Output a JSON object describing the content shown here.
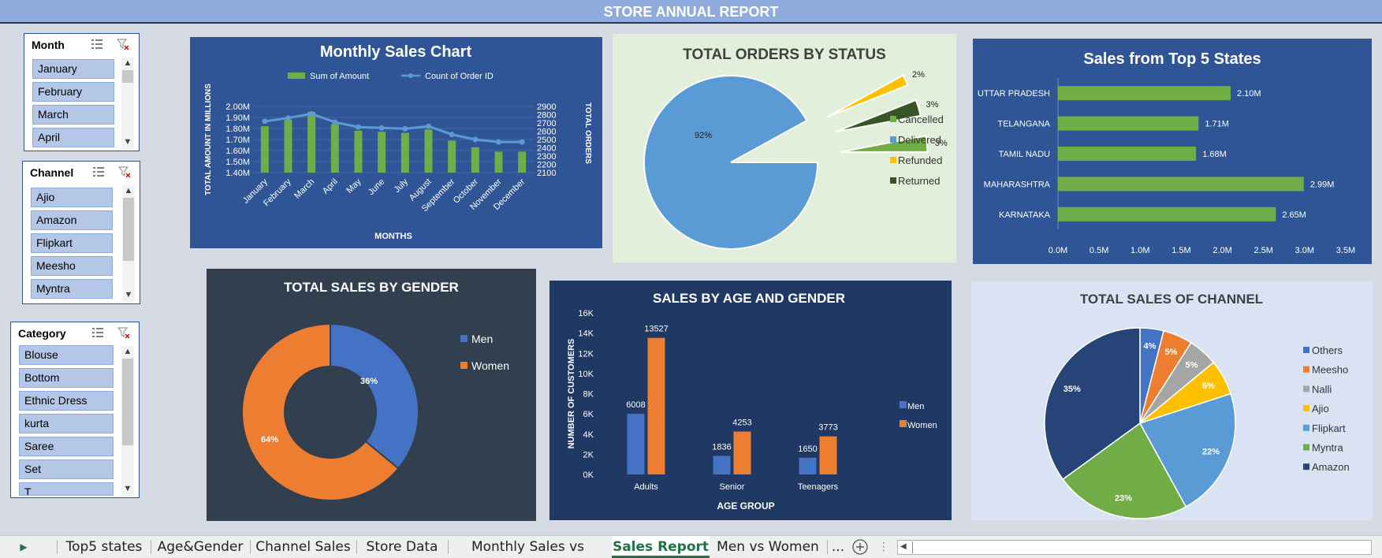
{
  "report_title": "STORE ANNUAL REPORT",
  "slicers": {
    "month": {
      "title": "Month",
      "items": [
        "January",
        "February",
        "March",
        "April"
      ]
    },
    "channel": {
      "title": "Channel",
      "items": [
        "Ajio",
        "Amazon",
        "Flipkart",
        "Meesho",
        "Myntra"
      ]
    },
    "category": {
      "title": "Category",
      "items": [
        "Blouse",
        "Bottom",
        "Ethnic Dress",
        "kurta",
        "Saree",
        "Set",
        "T"
      ]
    }
  },
  "colors": {
    "blue_panel": "#2f5597",
    "green_bar": "#70ad47",
    "line_blue": "#5b9bd5",
    "orange": "#ed7d31",
    "dark_panel": "#323f4f",
    "navy_panel": "#203864",
    "light_green_panel": "#e2efda",
    "light_blue_panel": "#dae3f3"
  },
  "tabs": [
    "Top5 states",
    "Age&Gender",
    "Channel Sales",
    "Store Data",
    "Monthly Sales vs Orders",
    "Sales Report",
    "Men vs Women",
    "..."
  ],
  "active_tab": "Sales Report",
  "icons": [
    "multi-select-icon",
    "clear-filter-icon",
    "scroll-up-icon",
    "scroll-down-icon",
    "next-sheet-icon",
    "new-sheet-icon"
  ],
  "chart_data": [
    {
      "type": "bar",
      "title": "Monthly Sales Chart",
      "xlabel": "MONTHS",
      "ylabel": "TOTAL AMOUNT IN MILLIONS",
      "y2label": "TOTAL ORDERS",
      "categories": [
        "January",
        "February",
        "March",
        "April",
        "May",
        "June",
        "July",
        "August",
        "September",
        "October",
        "November",
        "December"
      ],
      "series": [
        {
          "name": "Sum of Amount",
          "kind": "bar",
          "axis": "left",
          "values": [
            1.82,
            1.88,
            1.95,
            1.84,
            1.78,
            1.77,
            1.76,
            1.79,
            1.69,
            1.63,
            1.59,
            1.59
          ]
        },
        {
          "name": "Count of Order ID",
          "kind": "line",
          "axis": "right",
          "values": [
            2720,
            2760,
            2810,
            2710,
            2650,
            2640,
            2630,
            2660,
            2560,
            2500,
            2470,
            2470
          ]
        }
      ],
      "ylim": [
        1.4,
        2.0
      ],
      "yticks": [
        "1.40M",
        "1.50M",
        "1.60M",
        "1.70M",
        "1.80M",
        "1.90M",
        "2.00M"
      ],
      "y2lim": [
        2100,
        2900
      ],
      "y2ticks": [
        "2100",
        "2200",
        "2300",
        "2400",
        "2500",
        "2600",
        "2700",
        "2800",
        "2900"
      ],
      "legend": "top"
    },
    {
      "type": "pie",
      "title": "TOTAL ORDERS BY STATUS",
      "slices": [
        {
          "name": "Delivered",
          "value": 92,
          "label": "92%",
          "color": "#5b9bd5"
        },
        {
          "name": "Refunded",
          "value": 2,
          "label": "2%",
          "color": "#ffc000"
        },
        {
          "name": "Returned",
          "value": 3,
          "label": "3%",
          "color": "#375623"
        },
        {
          "name": "Cancelled",
          "value": 3,
          "label": "3%",
          "color": "#70ad47"
        }
      ],
      "legend_order": [
        "Cancelled",
        "Delivered",
        "Refunded",
        "Returned"
      ],
      "legend": "right"
    },
    {
      "type": "bar",
      "orientation": "horizontal",
      "title": "Sales from Top 5 States",
      "categories": [
        "UTTAR PRADESH",
        "TELANGANA",
        "TAMIL NADU",
        "MAHARASHTRA",
        "KARNATAKA"
      ],
      "values": [
        2.1,
        1.71,
        1.68,
        2.99,
        2.65
      ],
      "data_labels": [
        "2.10M",
        "1.71M",
        "1.68M",
        "2.99M",
        "2.65M"
      ],
      "xlim": [
        0,
        3.5
      ],
      "xticks": [
        "0.0M",
        "0.5M",
        "1.0M",
        "1.5M",
        "2.0M",
        "2.5M",
        "3.0M",
        "3.5M"
      ]
    },
    {
      "type": "pie",
      "subtype": "donut",
      "title": "TOTAL SALES BY GENDER",
      "slices": [
        {
          "name": "Men",
          "value": 36,
          "label": "36%",
          "color": "#4472c4"
        },
        {
          "name": "Women",
          "value": 64,
          "label": "64%",
          "color": "#ed7d31"
        }
      ],
      "legend": "right"
    },
    {
      "type": "bar",
      "title": "SALES BY AGE AND GENDER",
      "xlabel": "AGE GROUP",
      "ylabel": "NUMBER OF CUSTOMERS",
      "categories": [
        "Adults",
        "Senior",
        "Teenagers"
      ],
      "series": [
        {
          "name": "Men",
          "values": [
            6008,
            1836,
            1650
          ],
          "color": "#4472c4"
        },
        {
          "name": "Women",
          "values": [
            13527,
            4253,
            3773
          ],
          "color": "#ed7d31"
        }
      ],
      "ylim": [
        0,
        16000
      ],
      "yticks": [
        "0K",
        "2K",
        "4K",
        "6K",
        "8K",
        "10K",
        "12K",
        "14K",
        "16K"
      ],
      "legend": "right"
    },
    {
      "type": "pie",
      "title": "TOTAL SALES OF CHANNEL",
      "slices": [
        {
          "name": "Others",
          "value": 4,
          "label": "4%",
          "color": "#4472c4"
        },
        {
          "name": "Meesho",
          "value": 5,
          "label": "5%",
          "color": "#ed7d31"
        },
        {
          "name": "Nalli",
          "value": 5,
          "label": "5%",
          "color": "#a5a5a5"
        },
        {
          "name": "Ajio",
          "value": 6,
          "label": "6%",
          "color": "#ffc000"
        },
        {
          "name": "Flipkart",
          "value": 22,
          "label": "22%",
          "color": "#5b9bd5"
        },
        {
          "name": "Myntra",
          "value": 23,
          "label": "23%",
          "color": "#70ad47"
        },
        {
          "name": "Amazon",
          "value": 35,
          "label": "35%",
          "color": "#264478"
        }
      ],
      "legend": "right"
    }
  ]
}
